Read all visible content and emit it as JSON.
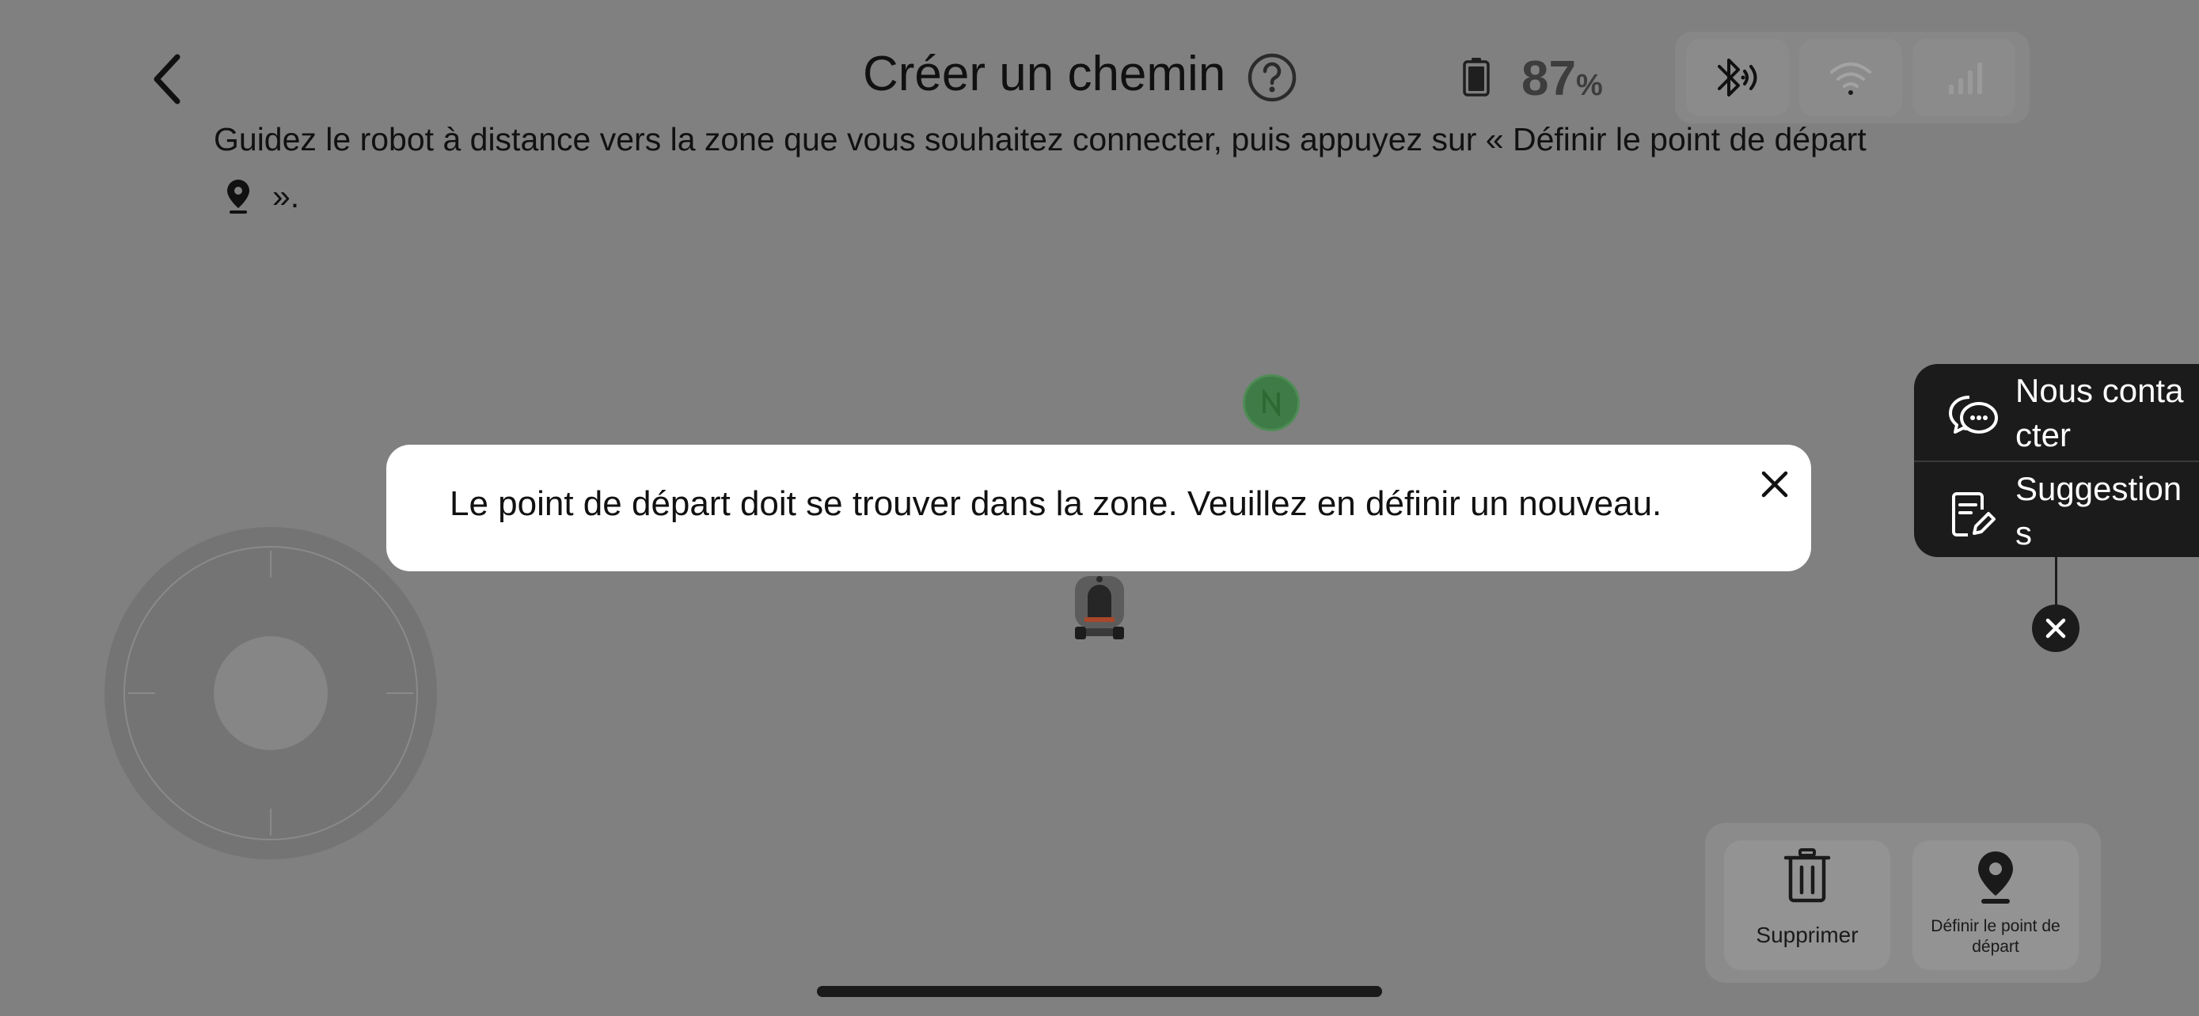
{
  "header": {
    "title": "Créer un chemin",
    "battery_value": "87",
    "battery_unit": "%"
  },
  "instructions": {
    "line1": "Guidez le robot à distance vers la zone que vous souhaitez connecter, puis appuyez sur « Définir le point de départ",
    "line2_suffix": "»."
  },
  "toast": {
    "message": "Le point de départ doit se trouver dans la zone. Veuillez en définir un nouveau."
  },
  "help_menu": {
    "items": [
      {
        "label": "Nous contacter",
        "icon": "chat-bubbles-icon"
      },
      {
        "label": "Suggestions",
        "icon": "document-edit-icon"
      }
    ]
  },
  "actions": {
    "delete_label": "Supprimer",
    "set_start_label": "Définir le point de départ"
  },
  "colors": {
    "overlay_background": "#808080",
    "north_marker": "#3f7b46",
    "robot_accent": "#c0502a"
  }
}
